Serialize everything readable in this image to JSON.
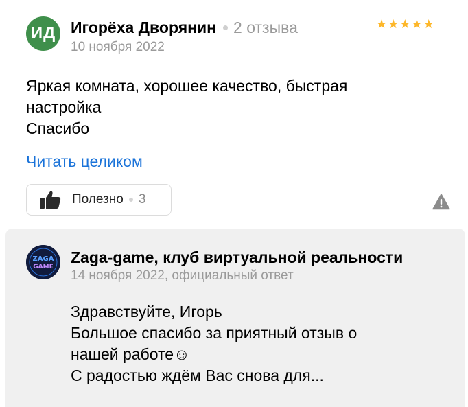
{
  "review": {
    "avatar_initials": "ИД",
    "avatar_color": "#3f8f4b",
    "author": "Игорёха Дворянин",
    "reviews_count": "2 отзыва",
    "date": "10 ноября 2022",
    "rating": 5,
    "star_color": "#fdb72a",
    "text_lines": [
      "Яркая комната, хорошее качество, быстрая\nнастройка",
      "Спасибо"
    ],
    "read_more": "Читать целиком",
    "helpful_label": "Полезно",
    "helpful_count": "3",
    "report_icon": "warning-icon"
  },
  "reply": {
    "business_name": "Zaga-game, клуб виртуальной реальности",
    "meta": "14 ноября 2022, официальный ответ",
    "logo_text": [
      "ZAGA",
      "GAME"
    ],
    "text_lines": [
      "Здравствуйте, Игорь",
      "Большое спасибо за приятный отзыв о\nнашей работе☺",
      "С радостью ждём Вас снова для..."
    ]
  },
  "accent_link_color": "#1a73d9"
}
